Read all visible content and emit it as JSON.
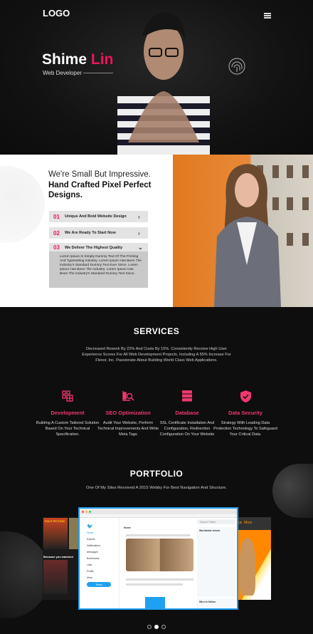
{
  "header": {
    "logo": "LOGO",
    "menu_icon": "hamburger-icon"
  },
  "hero": {
    "first_name": "Shime",
    "last_name": "Lin",
    "role": "Web Developer",
    "icon": "fingerprint-icon"
  },
  "about": {
    "tagline": "We're Small But Impressive.",
    "headline": "Hand Crafted Pixel Perfect Designs.",
    "accordion": [
      {
        "num": "01",
        "label": "Unique And Bold Website Design",
        "expanded": false
      },
      {
        "num": "02",
        "label": "We Are Ready To Start Now",
        "expanded": false
      },
      {
        "num": "03",
        "label": "We Deliver The Highest Quality",
        "expanded": true,
        "body": "Lorem Ipsum Is Simply Dummy Text Of The Printing And Typesetting Industry. Lorem Ipsum Has Been The Industry's Standard Dummy Text Ever Since. Lorem Ipsum Has Been The Industry. Lorem Ipsum Has Been The Industry's Standard Dummy Text Since."
      }
    ]
  },
  "services": {
    "title": "SERVICES",
    "intro": "Decreased Rework By 22% And Costs By 15%. Consistently Receive High User Experience Scores For All Web Development Projects, Including A 55% Increase For Flexor, Inc. Passionate About Building World Class Web Applications.",
    "items": [
      {
        "title": "Development",
        "desc": "Building A Custom Tailored Solution Based On Your Technical Specification.",
        "icon": "grid-blocks-icon"
      },
      {
        "title": "SEO Optimization",
        "desc": "Audit Your Website, Perform Technical Improvements And Write Meta Tags",
        "icon": "seo-search-icon"
      },
      {
        "title": "Database",
        "desc": "SSL Certificate Installation And Configuration, Redirection Configuration On Your Website",
        "icon": "database-icon"
      },
      {
        "title": "Data Security",
        "desc": "Strategy With Leading Data Protection Technology To Safeguard Your Critical Data.",
        "icon": "shield-check-icon"
      }
    ],
    "accent": "#f0386e"
  },
  "portfolio": {
    "title": "PORTFOLIO",
    "subtitle": "One Of My Sites Received A 2015 Webby For Best Navigation And Structure.",
    "left_card": {
      "poster": "PULP FICTION",
      "row_label": "Because you watched"
    },
    "right_card": {
      "nav": [
        "us",
        "More"
      ]
    },
    "twitter": {
      "nav": [
        "Home",
        "Explore",
        "Notifications",
        "Messages",
        "Bookmarks",
        "Lists",
        "Profile",
        "More"
      ],
      "tweet_button": "Tweet",
      "feed_title": "Home",
      "search": "Search Twitter",
      "trends_title": "Worldwide trends",
      "follow_title": "Who to follow"
    },
    "slides": 3,
    "active_slide": 2
  }
}
